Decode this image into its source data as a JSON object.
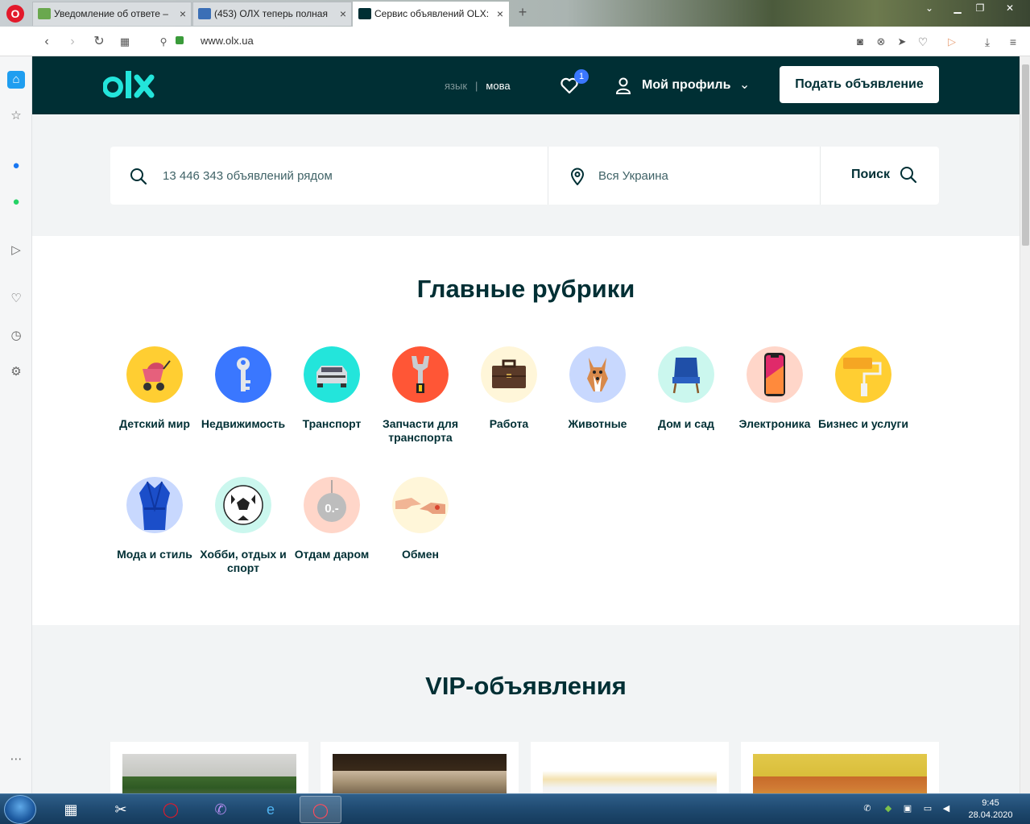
{
  "browser": {
    "tabs": [
      {
        "title": "Уведомление об ответе –"
      },
      {
        "title": "(453) ОЛХ теперь полная"
      },
      {
        "title": "Сервис объявлений OLX: "
      }
    ],
    "url": "www.olx.ua"
  },
  "header": {
    "lang_ru": "язык",
    "lang_sep": "|",
    "lang_ua": "мова",
    "favorites_count": "1",
    "profile_label": "Мой профиль",
    "post_button": "Подать объявление"
  },
  "search": {
    "query_placeholder": "13 446 343 объявлений рядом",
    "location_placeholder": "Вся Украина",
    "button_label": "Поиск"
  },
  "categories": {
    "title": "Главные рубрики",
    "items": [
      {
        "label": "Детский мир",
        "icon": "stroller-icon",
        "bg": "#ffce32"
      },
      {
        "label": "Недвижимость",
        "icon": "key-icon",
        "bg": "#3a77ff"
      },
      {
        "label": "Транспорт",
        "icon": "car-icon",
        "bg": "#23e5db"
      },
      {
        "label": "Запчасти для транспорта",
        "icon": "wrench-icon",
        "bg": "#ff5636"
      },
      {
        "label": "Работа",
        "icon": "briefcase-icon",
        "bg": "#fff6d9"
      },
      {
        "label": "Животные",
        "icon": "dog-icon",
        "bg": "#c8d8fe"
      },
      {
        "label": "Дом и сад",
        "icon": "armchair-icon",
        "bg": "#cbf7ee"
      },
      {
        "label": "Электроника",
        "icon": "phone-icon",
        "bg": "#ffd6c9"
      },
      {
        "label": "Бизнес и услуги",
        "icon": "paint-roller-icon",
        "bg": "#ffce32"
      },
      {
        "label": "Мода и стиль",
        "icon": "robe-icon",
        "bg": "#c8d8fe"
      },
      {
        "label": "Хобби, отдых и спорт",
        "icon": "football-icon",
        "bg": "#cbf7ee"
      },
      {
        "label": "Отдам даром",
        "icon": "free-tag-icon",
        "bg": "#ffd6c9"
      },
      {
        "label": "Обмен",
        "icon": "hands-exchange-icon",
        "bg": "#fff6d9"
      }
    ]
  },
  "vip": {
    "title": "VIP-объявления"
  },
  "taskbar": {
    "time": "9:45",
    "date": "28.04.2020"
  },
  "colors": {
    "brand_dark": "#002f34",
    "brand_teal": "#23e5db",
    "badge_blue": "#3a77ff"
  }
}
